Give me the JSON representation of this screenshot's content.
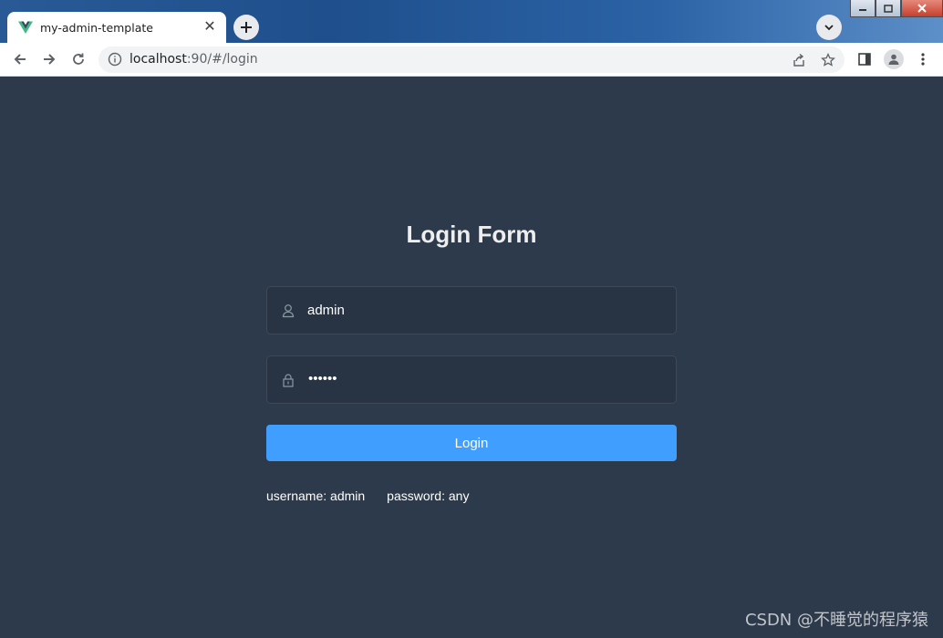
{
  "browser": {
    "tab_title": "my-admin-template",
    "url_host": "localhost",
    "url_path": ":90/#/login"
  },
  "login": {
    "title": "Login Form",
    "username_value": "admin",
    "password_value": "••••••",
    "button_label": "Login",
    "tip_username": "username: admin",
    "tip_password": "password: any"
  },
  "watermark": "CSDN @不睡觉的程序猿",
  "colors": {
    "page_bg": "#2d3a4b",
    "button_bg": "#409eff",
    "title_text": "#eeeeee"
  },
  "icons": {
    "favicon": "vue-logo",
    "username": "user-icon",
    "password": "lock-icon"
  }
}
